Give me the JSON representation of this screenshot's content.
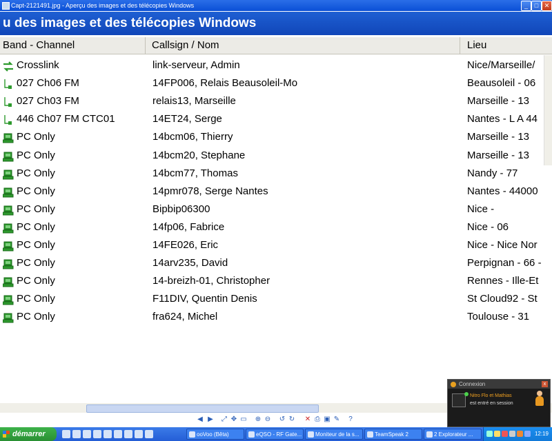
{
  "window": {
    "title": "Capt-2121491.jpg - Aperçu des images et des télécopies Windows",
    "controls": {
      "minimize": "_",
      "maximize": "□",
      "close": "✕"
    }
  },
  "header": {
    "title": "u des images et des télécopies Windows"
  },
  "columns": [
    "Band - Channel",
    "Callsign / Nom",
    "Lieu"
  ],
  "rows": [
    {
      "icon": "crosslink-icon",
      "band": "Crosslink",
      "callsign": "link-serveur, Admin",
      "lieu": "Nice/Marseille/"
    },
    {
      "icon": "radio-link-icon",
      "band": "027 Ch06 FM",
      "callsign": "14FP006, Relais Beausoleil-Mo",
      "lieu": "Beausoleil - 06"
    },
    {
      "icon": "radio-link-icon",
      "band": "027 Ch03 FM",
      "callsign": "relais13, Marseille",
      "lieu": "Marseille - 13"
    },
    {
      "icon": "radio-link-icon",
      "band": "446 Ch07 FM CTC01",
      "callsign": "14ET24, Serge",
      "lieu": "Nantes - L A 44"
    },
    {
      "icon": "pc-icon",
      "band": "PC Only",
      "callsign": "14bcm06, Thierry",
      "lieu": "Marseille - 13"
    },
    {
      "icon": "pc-icon",
      "band": "PC Only",
      "callsign": "14bcm20, Stephane",
      "lieu": "Marseille - 13"
    },
    {
      "icon": "pc-icon",
      "band": "PC Only",
      "callsign": "14bcm77, Thomas",
      "lieu": "Nandy - 77"
    },
    {
      "icon": "pc-icon",
      "band": "PC Only",
      "callsign": "14pmr078, Serge Nantes",
      "lieu": "Nantes - 44000"
    },
    {
      "icon": "pc-icon",
      "band": "PC Only",
      "callsign": "Bipbip06300",
      "lieu": "Nice -"
    },
    {
      "icon": "pc-icon",
      "band": "PC Only",
      "callsign": "14fp06, Fabrice",
      "lieu": "Nice - 06"
    },
    {
      "icon": "pc-icon",
      "band": "PC Only",
      "callsign": "14FE026, Eric",
      "lieu": "Nice - Nice Nor"
    },
    {
      "icon": "pc-icon",
      "band": "PC Only",
      "callsign": "14arv235, David",
      "lieu": "Perpignan - 66 -"
    },
    {
      "icon": "pc-icon",
      "band": "PC Only",
      "callsign": "14-breizh-01, Christopher",
      "lieu": "Rennes - Ille-Et"
    },
    {
      "icon": "pc-icon",
      "band": "PC Only",
      "callsign": "F11DIV, Quentin Denis",
      "lieu": "St Cloud92 - St"
    },
    {
      "icon": "pc-icon",
      "band": "PC Only",
      "callsign": "fra624, Michel",
      "lieu": "Toulouse - 31"
    }
  ],
  "taskbar": {
    "start_label": "démarrer",
    "tasks": [
      "ooVoo (Bêta)",
      "eQSO - RF Gate...",
      "Moniteur de la s...",
      "TeamSpeak 2",
      "2 Explorateur ..."
    ],
    "clock": "12:19"
  },
  "notification": {
    "title": "Connexion",
    "line1": "Nitro Flo et Mathias",
    "line2": "est entré en session"
  },
  "colors": {
    "titlebar": "#0a4fd6",
    "start": "#3aa63a",
    "pc_icon": "#2e9a2e"
  }
}
